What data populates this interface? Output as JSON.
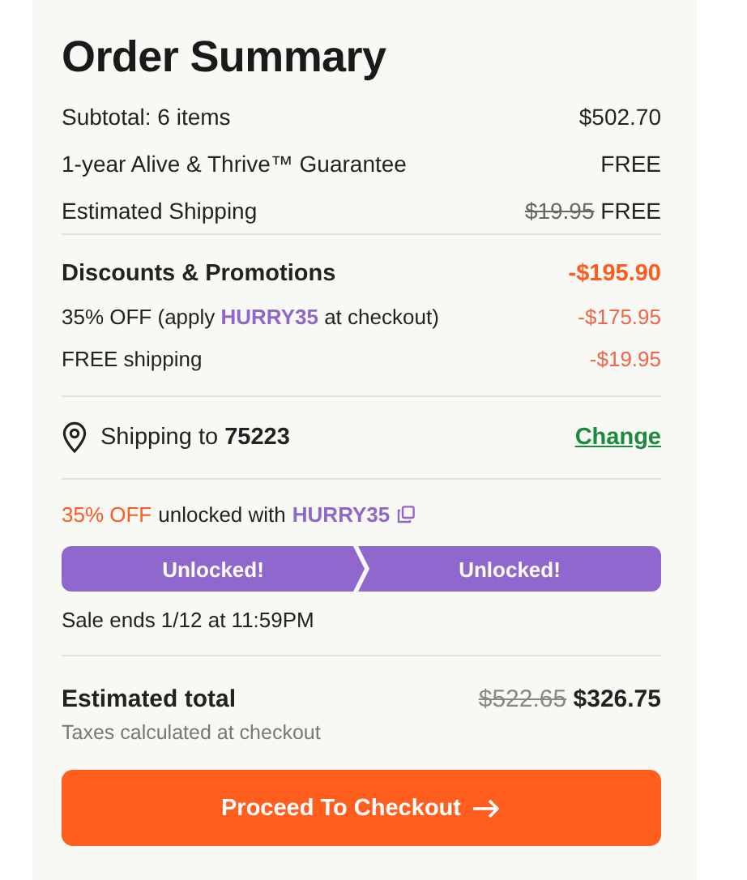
{
  "title": "Order Summary",
  "lines": [
    {
      "label": "Subtotal: 6 items",
      "value": "$502.70"
    },
    {
      "label": "1-year Alive & Thrive™ Guarantee",
      "value": "FREE"
    },
    {
      "label": "Estimated Shipping",
      "old_value": "$19.95",
      "value": "FREE"
    }
  ],
  "discounts": {
    "label": "Discounts & Promotions",
    "total": "-$195.90",
    "items": [
      {
        "label": "35% OFF (apply **HURRY35** at checkout)",
        "value": "-$175.95"
      },
      {
        "label": "FREE shipping",
        "value": "-$19.95"
      }
    ]
  },
  "shipping": {
    "label": "Shipping to **75223**",
    "link": "Change"
  },
  "promo": {
    "discount": "35% OFF",
    "text": "unlocked with",
    "code": "HURRY35",
    "steps": [
      {
        "label": "Unlocked!",
        "unlocked": true
      },
      {
        "label": "Unlocked!",
        "unlocked": true
      }
    ],
    "sale_note": "Sale ends 1/12 at 11:59PM"
  },
  "total": {
    "label": "Estimated total",
    "old_value": "$522.65",
    "value": "$326.75",
    "note": "Taxes calculated at checkout"
  },
  "checkout_button": "Proceed To Checkout"
}
